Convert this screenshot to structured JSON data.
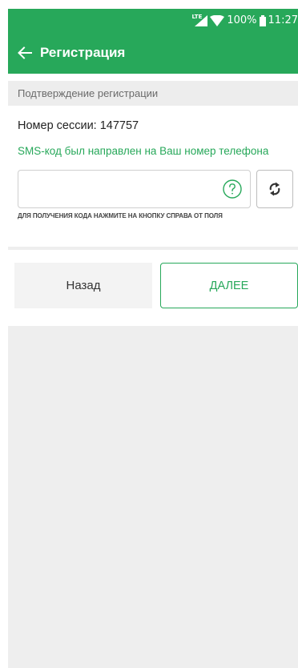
{
  "status_bar": {
    "network": "LTE",
    "battery": "100%",
    "time": "11:27"
  },
  "app_bar": {
    "title": "Регистрация"
  },
  "section": {
    "header": "Подтверждение регистрации"
  },
  "session": {
    "label": "Номер сессии: 147757"
  },
  "sms": {
    "notice": "SMS-код был направлен на Ваш номер телефона",
    "code_value": "",
    "code_placeholder": "",
    "hint": "ДЛЯ ПОЛУЧЕНИЯ КОДА НАЖМИТЕ НА КНОПКУ СПРАВА ОТ ПОЛЯ"
  },
  "buttons": {
    "back": "Назад",
    "next": "ДАЛЕЕ"
  },
  "icons": {
    "back": "arrow-left-icon",
    "help": "question-circle-icon",
    "refresh": "refresh-icon",
    "signal": "cellular-signal-icon",
    "wifi": "wifi-icon",
    "battery": "battery-icon"
  },
  "colors": {
    "primary": "#27a85a",
    "background": "#eeeeee",
    "section_header_bg": "#ededed"
  }
}
